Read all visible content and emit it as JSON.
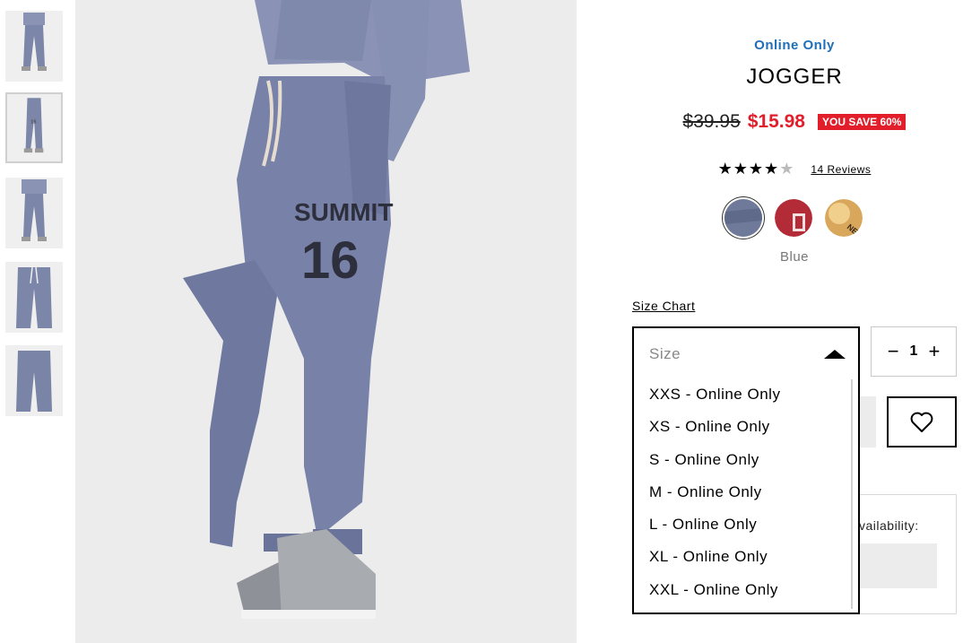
{
  "thumbnails": [
    {
      "label": "Full body view"
    },
    {
      "label": "Side view"
    },
    {
      "label": "Back view"
    },
    {
      "label": "Flat front"
    },
    {
      "label": "Flat back"
    }
  ],
  "main_image": {
    "print_line1": "SUMMIT",
    "print_line2": "16"
  },
  "product": {
    "badge": "Online Only",
    "title": "JOGGER",
    "price_was": "$39.95",
    "price_now": "$15.98",
    "savings": "YOU SAVE 60%",
    "rating_stars": "★★★★",
    "rating_half": "★",
    "reviews": "14 Reviews",
    "color_name": "Blue",
    "swatches": [
      {
        "name": "blue",
        "color": "#6f7a9a"
      },
      {
        "name": "red",
        "color": "#b32b37"
      },
      {
        "name": "gold",
        "color": "#d9a75b"
      }
    ]
  },
  "size_chart": "Size Chart",
  "size_select": {
    "placeholder": "Size",
    "options": [
      "XXS - Online Only",
      "XS - Online Only",
      "S - Online Only",
      "M - Online Only",
      "L - Online Only",
      "XL - Online Only",
      "XXL - Online Only"
    ]
  },
  "quantity": {
    "minus": "−",
    "value": "1",
    "plus": "+"
  },
  "availability": {
    "label": "vailability:"
  },
  "colors": {
    "accent_blue": "#1f6fb8",
    "sale_red": "#e21e2a"
  }
}
